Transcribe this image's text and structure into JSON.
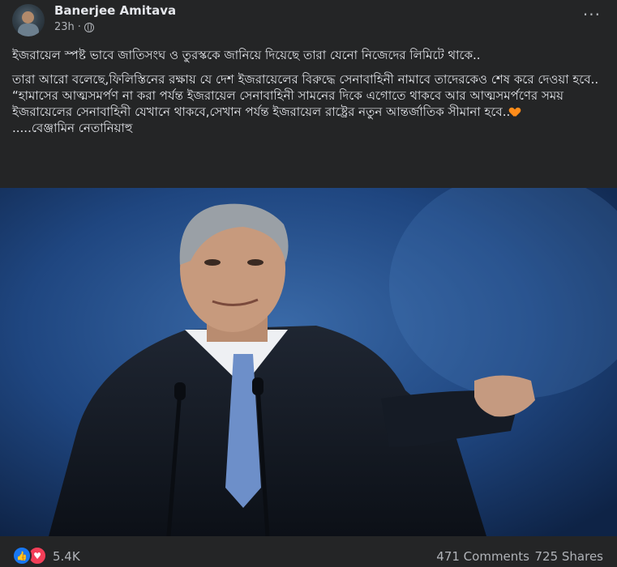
{
  "post": {
    "author": "Banerjee Amitava",
    "time": "23h",
    "separator": "·",
    "more_icon": "more-horizontal-icon",
    "privacy_icon": "globe-icon",
    "text": {
      "line1": "ইজরায়েল স্পষ্ট ভাবে জাতিসংঘ ও তুরস্ককে জানিয়ে দিয়েছে তারা যেনো নিজেদের লিমিটে থাকে..",
      "line2": "তারা আরো বলেছে,ফিলিস্তিনের রক্ষায় যে দেশ ইজরায়েলের বিরুদ্ধে সেনাবাহিনী নামাবে তাদেরকেও শেষ করে দেওয়া হবে..",
      "line3": " “হামাসের আত্মসমর্পণ না করা পর্যন্ত ইজরায়েল সেনাবাহিনী সামনের দিকে এগোতে থাকবে আর আত্মসমর্পণের সময় ইজরায়েলের সেনাবাহিনী যেখানে থাকবে,সেখান পর্যন্ত ইজরায়েল রাষ্ট্রের নতুন আন্তর্জাতিক সীমানা হবে..",
      "line4": ".....বেঞ্জামিন নেতানিয়াহু"
    },
    "emoji_icon": "orange-heart-icon"
  },
  "stats": {
    "reactions_icons": [
      "like-icon",
      "love-icon"
    ],
    "reaction_count": "5.4K",
    "comments": "471 Comments",
    "shares": "725 Shares"
  },
  "colors": {
    "background": "#242526",
    "text": "#e4e6eb",
    "secondary_text": "#b0b3b8",
    "like_blue": "#1877f2",
    "love_red": "#f33e58",
    "photo_backdrop": "#1b3f73"
  }
}
